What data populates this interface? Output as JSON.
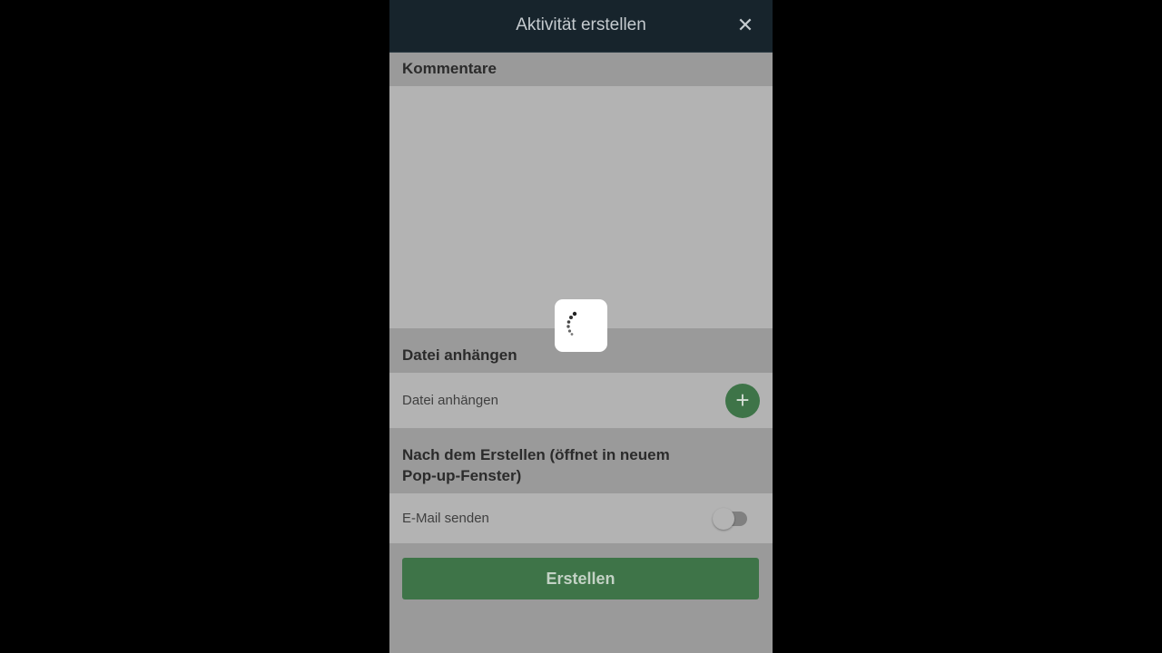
{
  "header": {
    "title": "Aktivität erstellen",
    "close_symbol": "✕"
  },
  "comments": {
    "title": "Kommentare",
    "value": ""
  },
  "attach": {
    "section_title": "Datei anhängen",
    "row_label": "Datei anhängen",
    "add_symbol": "+"
  },
  "after_create": {
    "section_title_line1": "Nach dem Erstellen (öffnet in neuem",
    "section_title_line2": "Pop-up-Fenster)",
    "email_label": "E-Mail senden",
    "email_toggle_on": false
  },
  "submit": {
    "label": "Erstellen"
  },
  "colors": {
    "header_bg": "#17242c",
    "accent_green": "#3e7448",
    "overlay_gray": "#9a9a9a"
  },
  "icons": {
    "close": "close-icon",
    "add": "plus-icon",
    "loading": "loading-spinner-icon"
  }
}
